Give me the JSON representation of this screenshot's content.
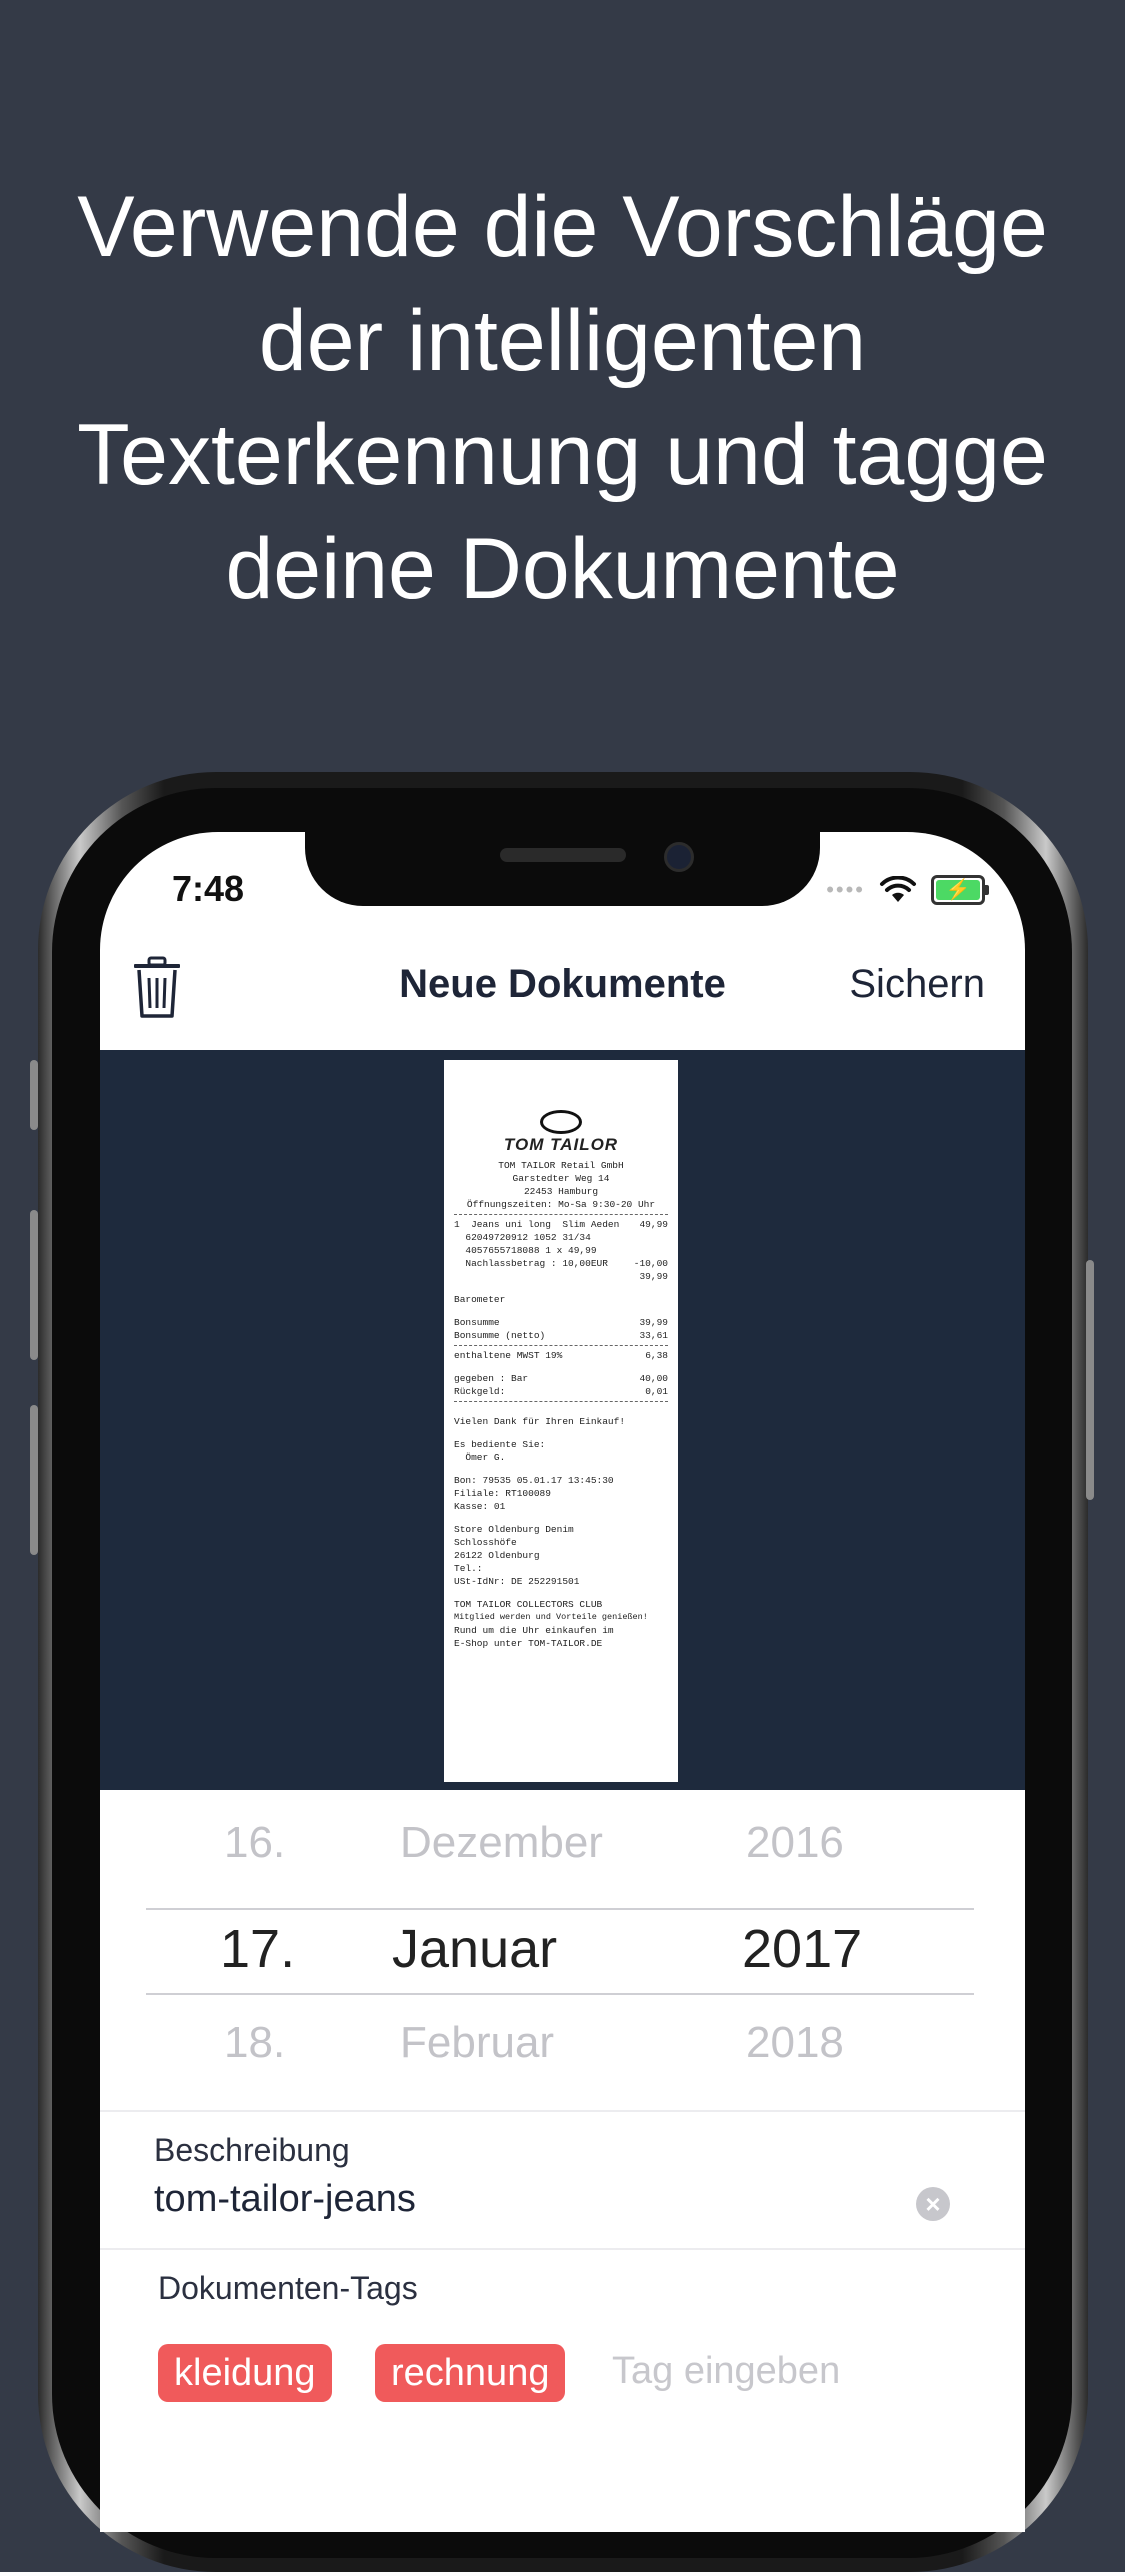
{
  "headline": {
    "lines": [
      "Verwende die Vorschläge",
      "der intelligenten",
      "Texterkennung und tagge",
      "deine Dokumente"
    ]
  },
  "status_bar": {
    "time": "7:48"
  },
  "navbar": {
    "title": "Neue Dokumente",
    "save_label": "Sichern"
  },
  "receipt": {
    "brand": "TOM TAILOR",
    "header_lines": [
      "TOM TAILOR Retail GmbH",
      "Garstedter Weg 14",
      "22453 Hamburg",
      "Öffnungszeiten: Mo-Sa 9:30-20 Uhr"
    ],
    "items": [
      {
        "left": "1  Jeans uni long  Slim Aeden",
        "right": "49,99"
      },
      {
        "left": "  62049720912 1052 31/34",
        "right": ""
      },
      {
        "left": "  4057655718088 1 x 49,99",
        "right": ""
      },
      {
        "left": "  Nachlassbetrag : 10,00EUR",
        "right": "-10,00"
      },
      {
        "left": "",
        "right": "39,99"
      }
    ],
    "summary": [
      {
        "left": "Barometer",
        "right": ""
      },
      {
        "left": "Bonsumme",
        "right": "39,99"
      },
      {
        "left": "Bonsumme (netto)",
        "right": "33,61"
      },
      {
        "left": "enthaltene MWST 19%",
        "right": "6,38"
      },
      {
        "left": "gegeben : Bar",
        "right": "40,00"
      },
      {
        "left": "Rückgeld:",
        "right": "0,01"
      }
    ],
    "thanks": "Vielen Dank für Ihren Einkauf!",
    "served_by": [
      "Es bediente Sie:",
      "  Ömer G."
    ],
    "bon_lines": [
      "Bon: 79535 05.01.17 13:45:30",
      "Filiale: RT100089",
      "Kasse: 01"
    ],
    "store_lines": [
      "Store Oldenburg Denim",
      "Schlosshöfe",
      "26122 Oldenburg",
      "Tel.:",
      "USt-IdNr: DE 252291501"
    ],
    "club_lines": [
      "TOM TAILOR COLLECTORS CLUB",
      "Mitglied werden und Vorteile genießen!",
      "Rund um die Uhr einkaufen im",
      "E-Shop unter TOM-TAILOR.DE"
    ]
  },
  "date_picker": {
    "above": {
      "day": "16.",
      "month": "Dezember",
      "year": "2016"
    },
    "selected": {
      "day": "17.",
      "month": "Januar",
      "year": "2017"
    },
    "below": {
      "day": "18.",
      "month": "Februar",
      "year": "2018"
    }
  },
  "description": {
    "label": "Beschreibung",
    "value": "tom-tailor-jeans",
    "clear_symbol": "×"
  },
  "tags": {
    "label": "Dokumenten-Tags",
    "items": [
      "kleidung",
      "rechnung"
    ],
    "input_placeholder": "Tag eingeben"
  },
  "colors": {
    "background": "#343a47",
    "doc_area": "#1e2a3d",
    "tag": "#f05a5b",
    "battery": "#4cd964"
  },
  "icons": {
    "trash": "trash-icon",
    "wifi": "wifi-icon",
    "battery": "battery-charging-icon",
    "clear": "clear-icon"
  }
}
